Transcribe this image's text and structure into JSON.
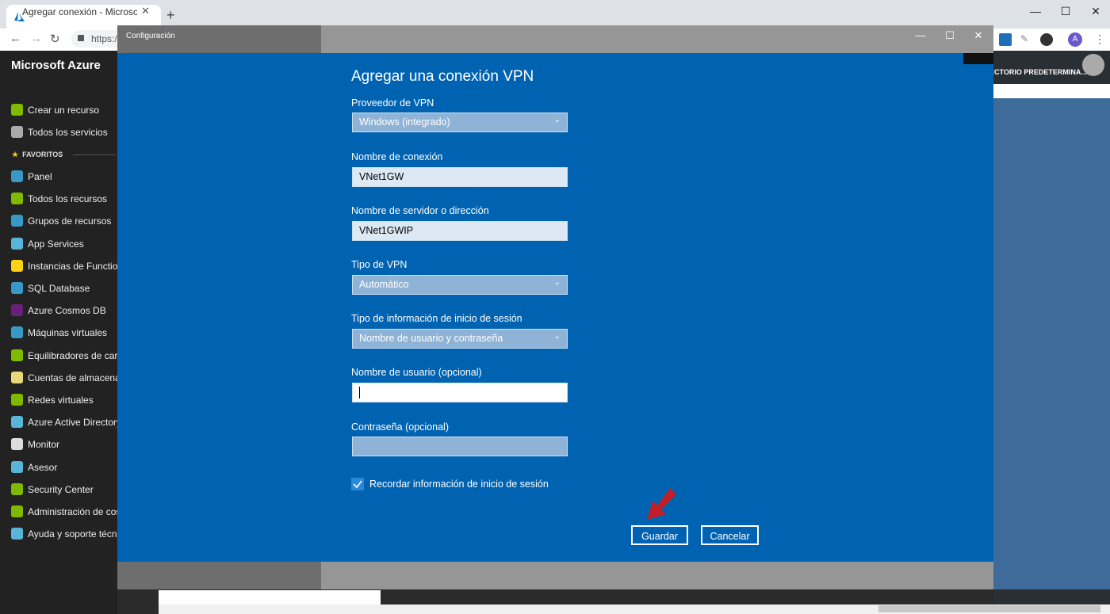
{
  "browser": {
    "tab_title": "Agregar conexión - Microsoft Az",
    "tab_close": "✕",
    "new_tab": "+",
    "url_prefix": "https:/",
    "window_min": "—",
    "window_max": "☐",
    "window_close": "✕",
    "profile_initial": "A"
  },
  "azure": {
    "brand": "Microsoft Azure",
    "favorites_label": "FAVORITOS",
    "directory_label": "ECTORIO PREDETERMINA...",
    "sidebar_top": [
      {
        "label": "Crear un recurso",
        "icon": "plus-icon"
      },
      {
        "label": "Todos los servicios",
        "icon": "list-icon"
      }
    ],
    "sidebar_items": [
      {
        "label": "Panel",
        "icon": "dashboard-icon"
      },
      {
        "label": "Todos los recursos",
        "icon": "grid-icon"
      },
      {
        "label": "Grupos de recursos",
        "icon": "cube-icon"
      },
      {
        "label": "App Services",
        "icon": "globe-icon"
      },
      {
        "label": "Instancias de Function",
        "icon": "bolt-icon"
      },
      {
        "label": "SQL Database",
        "icon": "database-icon"
      },
      {
        "label": "Azure Cosmos DB",
        "icon": "planet-icon"
      },
      {
        "label": "Máquinas virtuales",
        "icon": "monitor-icon"
      },
      {
        "label": "Equilibradores de carg",
        "icon": "diamond-icon"
      },
      {
        "label": "Cuentas de almacenan",
        "icon": "storage-icon"
      },
      {
        "label": "Redes virtuales",
        "icon": "network-icon"
      },
      {
        "label": "Azure Active Directory",
        "icon": "aad-icon"
      },
      {
        "label": "Monitor",
        "icon": "gauge-icon"
      },
      {
        "label": "Asesor",
        "icon": "cloud-icon"
      },
      {
        "label": "Security Center",
        "icon": "shield-icon"
      },
      {
        "label": "Administración de cos",
        "icon": "cost-icon"
      },
      {
        "label": "Ayuda y soporte técni",
        "icon": "support-icon"
      }
    ]
  },
  "dialog": {
    "window_title": "Configuración",
    "btn_min": "—",
    "btn_max": "☐",
    "btn_close": "✕",
    "heading": "Agregar una conexión VPN",
    "provider_label": "Proveedor de VPN",
    "provider_value": "Windows (integrado)",
    "connection_name_label": "Nombre de conexión",
    "connection_name_value": "VNet1GW",
    "server_label": "Nombre de servidor o dirección",
    "server_value": "VNet1GWIP",
    "vpn_type_label": "Tipo de VPN",
    "vpn_type_value": "Automático",
    "signin_type_label": "Tipo de información de inicio de sesión",
    "signin_type_value": "Nombre de usuario y contraseña",
    "username_label": "Nombre de usuario (opcional)",
    "username_value": "",
    "password_label": "Contraseña (opcional)",
    "password_value": "",
    "remember_label": "Recordar información de inicio de sesión",
    "remember_checked": true,
    "save_label": "Guardar",
    "cancel_label": "Cancelar"
  },
  "colors": {
    "dialog_blue": "#0063b1",
    "arrow_red": "#c0202a",
    "sidebar_bg": "#222222"
  }
}
